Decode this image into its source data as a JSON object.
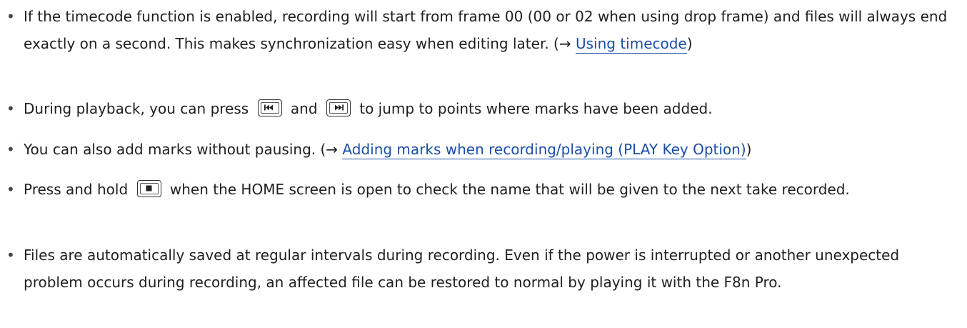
{
  "notes": [
    {
      "text": "If the timecode function is enabled, recording will start from frame 00 (00 or 02 when using drop frame) and files will always end exactly on a second. This makes synchronization easy when editing later. (→ ",
      "link": "Using timecode",
      "after": ")"
    },
    {
      "part1": "During playback, you can press ",
      "key1": "rewind-key-icon",
      "part2": " and ",
      "key2": "fast-forward-key-icon",
      "part3": " to jump to points where marks have been added."
    },
    {
      "text": "You can also add marks without pausing. (→ ",
      "link": "Adding marks when recording/playing (PLAY Key Option)",
      "after": ")"
    },
    {
      "part1": "Press and hold ",
      "key": "stop-key-icon",
      "part2": " when the HOME screen is open to check the name that will be given to the next take recorded."
    },
    {
      "text": "Files are automatically saved at regular intervals during recording. Even if the power is interrupted or another unexpected problem occurs during recording, an affected file can be restored to normal by playing it with the F8n Pro."
    }
  ],
  "colors": {
    "text": "#1f1f1f",
    "link": "#1a4fa8"
  }
}
